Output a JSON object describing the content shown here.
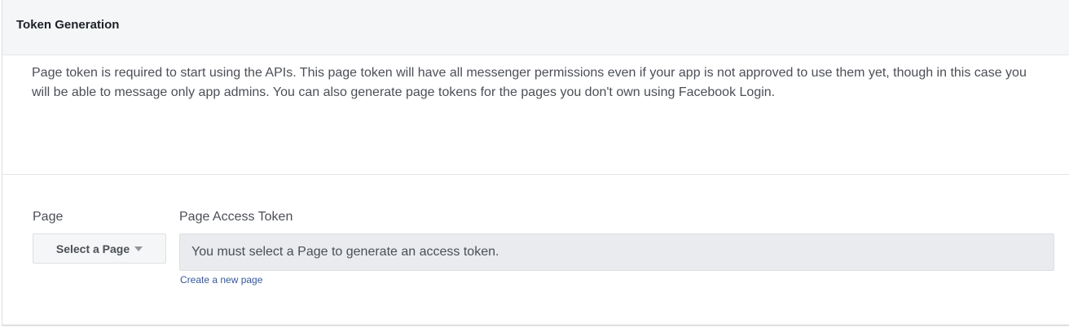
{
  "header": {
    "title": "Token Generation"
  },
  "description": "Page token is required to start using the APIs. This page token will have all messenger permissions even if your app is not approved to use them yet, though in this case you will be able to message only app admins. You can also generate page tokens for the pages you don't own using Facebook Login.",
  "form": {
    "page_label": "Page",
    "page_select": "Select a Page",
    "token_label": "Page Access Token",
    "token_value": "You must select a Page to generate an access token.",
    "create_link": "Create a new page"
  }
}
